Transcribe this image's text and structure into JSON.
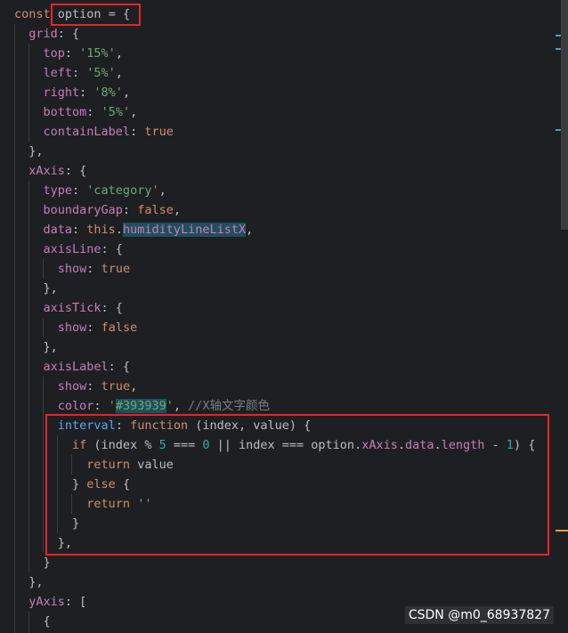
{
  "colors": {
    "background": "#1e1f22",
    "keyword": "#cf8e6d",
    "property": "#c77dbb",
    "string": "#6aab73",
    "number": "#2aacb8",
    "comment": "#7a7e85",
    "function": "#56a8f5",
    "default": "#bcbec4",
    "annotation_red": "#e3262b",
    "marker_cyan": "#2aacb8",
    "marker_orange": "#e0a040"
  },
  "watermark": "CSDN @m0_68937827",
  "code": [
    [
      {
        "t": "const ",
        "c": "kw"
      },
      {
        "t": "option",
        "c": "def"
      },
      {
        "t": " = {",
        "c": "def"
      }
    ],
    [
      {
        "t": "  "
      },
      {
        "t": "grid",
        "c": "prop"
      },
      {
        "t": ": {",
        "c": "def"
      }
    ],
    [
      {
        "t": "    "
      },
      {
        "t": "top",
        "c": "prop"
      },
      {
        "t": ": ",
        "c": "def"
      },
      {
        "t": "'15%'",
        "c": "str"
      },
      {
        "t": ",",
        "c": "def"
      }
    ],
    [
      {
        "t": "    "
      },
      {
        "t": "left",
        "c": "prop"
      },
      {
        "t": ": ",
        "c": "def"
      },
      {
        "t": "'5%'",
        "c": "str"
      },
      {
        "t": ",",
        "c": "def"
      }
    ],
    [
      {
        "t": "    "
      },
      {
        "t": "right",
        "c": "prop"
      },
      {
        "t": ": ",
        "c": "def"
      },
      {
        "t": "'8%'",
        "c": "str"
      },
      {
        "t": ",",
        "c": "def"
      }
    ],
    [
      {
        "t": "    "
      },
      {
        "t": "bottom",
        "c": "prop"
      },
      {
        "t": ": ",
        "c": "def"
      },
      {
        "t": "'5%'",
        "c": "str"
      },
      {
        "t": ",",
        "c": "def"
      }
    ],
    [
      {
        "t": "    "
      },
      {
        "t": "containLabel",
        "c": "prop"
      },
      {
        "t": ": ",
        "c": "def"
      },
      {
        "t": "true",
        "c": "kw"
      }
    ],
    [
      {
        "t": "  "
      },
      {
        "t": "},",
        "c": "def"
      }
    ],
    [
      {
        "t": "  "
      },
      {
        "t": "xAxis",
        "c": "prop"
      },
      {
        "t": ": {",
        "c": "def"
      }
    ],
    [
      {
        "t": "    "
      },
      {
        "t": "type",
        "c": "prop"
      },
      {
        "t": ": ",
        "c": "def"
      },
      {
        "t": "'category'",
        "c": "str"
      },
      {
        "t": ",",
        "c": "def"
      }
    ],
    [
      {
        "t": "    "
      },
      {
        "t": "boundaryGap",
        "c": "prop"
      },
      {
        "t": ": ",
        "c": "def"
      },
      {
        "t": "false",
        "c": "kw"
      },
      {
        "t": ",",
        "c": "def"
      }
    ],
    [
      {
        "t": "    "
      },
      {
        "t": "data",
        "c": "prop"
      },
      {
        "t": ": ",
        "c": "def"
      },
      {
        "t": "this",
        "c": "kw"
      },
      {
        "t": ".",
        "c": "def"
      },
      {
        "t": "humidityLineListX",
        "c": "prop",
        "hl": true
      },
      {
        "t": ",",
        "c": "def"
      }
    ],
    [
      {
        "t": "    "
      },
      {
        "t": "axisLine",
        "c": "prop"
      },
      {
        "t": ": {",
        "c": "def"
      }
    ],
    [
      {
        "t": "      "
      },
      {
        "t": "show",
        "c": "prop"
      },
      {
        "t": ": ",
        "c": "def"
      },
      {
        "t": "true",
        "c": "kw"
      }
    ],
    [
      {
        "t": "    "
      },
      {
        "t": "},",
        "c": "def"
      }
    ],
    [
      {
        "t": "    "
      },
      {
        "t": "axisTick",
        "c": "prop"
      },
      {
        "t": ": {",
        "c": "def"
      }
    ],
    [
      {
        "t": "      "
      },
      {
        "t": "show",
        "c": "prop"
      },
      {
        "t": ": ",
        "c": "def"
      },
      {
        "t": "false",
        "c": "kw"
      }
    ],
    [
      {
        "t": "    "
      },
      {
        "t": "},",
        "c": "def"
      }
    ],
    [
      {
        "t": "    "
      },
      {
        "t": "axisLabel",
        "c": "prop"
      },
      {
        "t": ": {",
        "c": "def"
      }
    ],
    [
      {
        "t": "      "
      },
      {
        "t": "show",
        "c": "prop"
      },
      {
        "t": ": ",
        "c": "def"
      },
      {
        "t": "true",
        "c": "kw"
      },
      {
        "t": ",",
        "c": "def"
      }
    ],
    [
      {
        "t": "      "
      },
      {
        "t": "color",
        "c": "prop"
      },
      {
        "t": ": ",
        "c": "def"
      },
      {
        "t": "'",
        "c": "str"
      },
      {
        "t": "#393939",
        "c": "str",
        "hl": true
      },
      {
        "t": "'",
        "c": "str"
      },
      {
        "t": ", ",
        "c": "def"
      },
      {
        "t": "//X轴文字颜色",
        "c": "cm"
      }
    ],
    [
      {
        "t": "      "
      },
      {
        "t": "interval",
        "c": "fn"
      },
      {
        "t": ": ",
        "c": "def"
      },
      {
        "t": "function",
        "c": "kw"
      },
      {
        "t": " (index, value) {",
        "c": "def"
      }
    ],
    [
      {
        "t": "        "
      },
      {
        "t": "if",
        "c": "kw"
      },
      {
        "t": " (index % ",
        "c": "def"
      },
      {
        "t": "5",
        "c": "num"
      },
      {
        "t": " === ",
        "c": "def"
      },
      {
        "t": "0",
        "c": "num"
      },
      {
        "t": " || index === option.",
        "c": "def"
      },
      {
        "t": "xAxis",
        "c": "prop"
      },
      {
        "t": ".",
        "c": "def"
      },
      {
        "t": "data",
        "c": "prop"
      },
      {
        "t": ".",
        "c": "def"
      },
      {
        "t": "length",
        "c": "prop"
      },
      {
        "t": " - ",
        "c": "def"
      },
      {
        "t": "1",
        "c": "num"
      },
      {
        "t": ") {",
        "c": "def"
      }
    ],
    [
      {
        "t": "          "
      },
      {
        "t": "return",
        "c": "kw"
      },
      {
        "t": " value",
        "c": "def"
      }
    ],
    [
      {
        "t": "        "
      },
      {
        "t": "} ",
        "c": "def"
      },
      {
        "t": "else",
        "c": "kw"
      },
      {
        "t": " {",
        "c": "def"
      }
    ],
    [
      {
        "t": "          "
      },
      {
        "t": "return",
        "c": "kw"
      },
      {
        "t": " ",
        "c": "def"
      },
      {
        "t": "''",
        "c": "str"
      }
    ],
    [
      {
        "t": "        "
      },
      {
        "t": "}",
        "c": "def"
      }
    ],
    [
      {
        "t": "      "
      },
      {
        "t": "},",
        "c": "def"
      }
    ],
    [
      {
        "t": "    "
      },
      {
        "t": "}",
        "c": "def"
      }
    ],
    [
      {
        "t": "  "
      },
      {
        "t": "},",
        "c": "def"
      }
    ],
    [
      {
        "t": "  "
      },
      {
        "t": "yAxis",
        "c": "prop"
      },
      {
        "t": ": [",
        "c": "def"
      }
    ],
    [
      {
        "t": "    "
      },
      {
        "t": "{",
        "c": "def"
      }
    ]
  ]
}
